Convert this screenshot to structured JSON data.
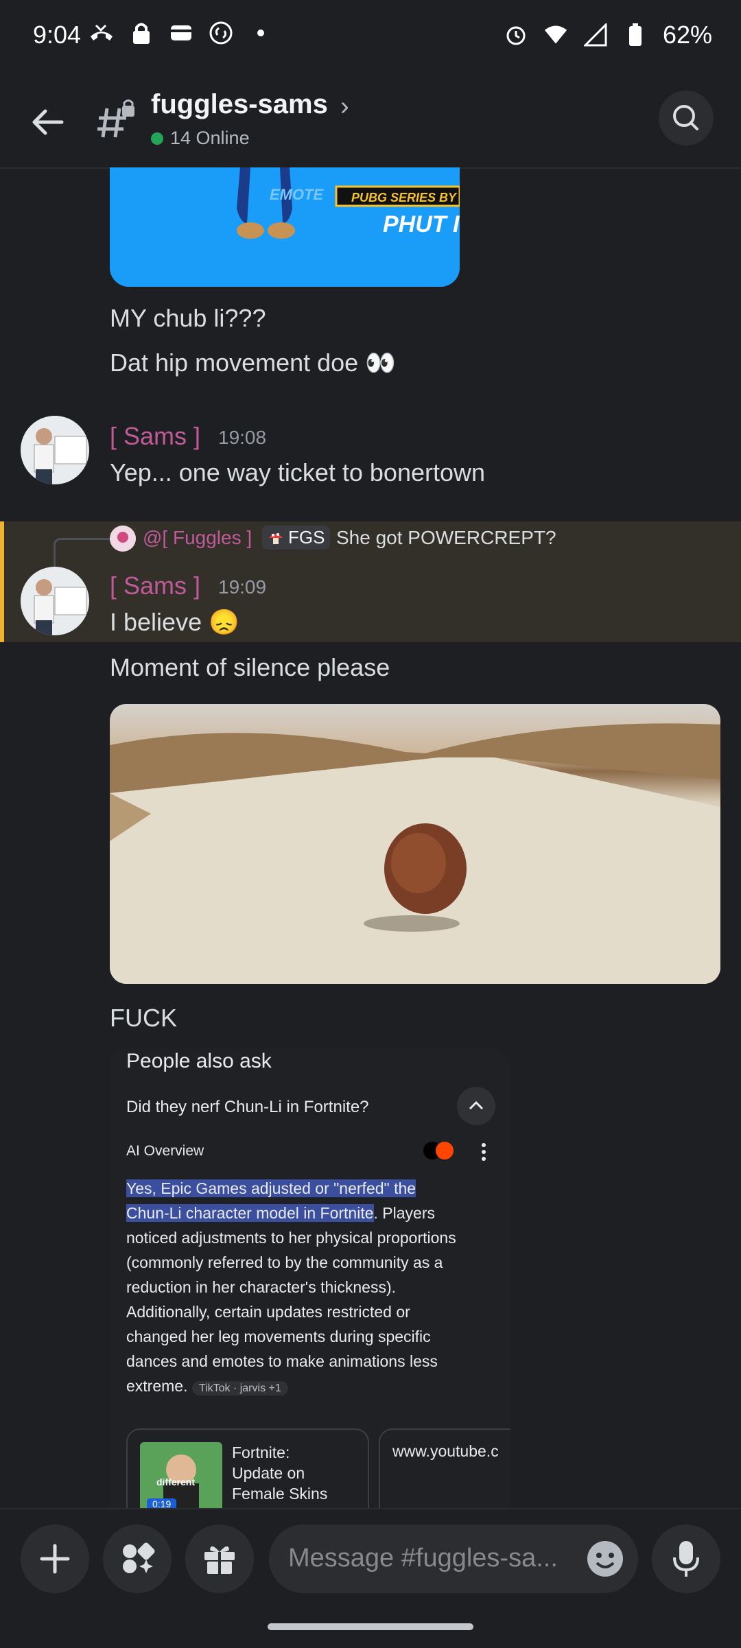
{
  "status_bar": {
    "time": "9:04",
    "battery": "62%"
  },
  "header": {
    "channel_name": "fuggles-sams",
    "chevron": "›",
    "online": "14 Online"
  },
  "messages": {
    "img1_overlay_emote": "EMOTE",
    "img1_overlay_series": "PUBG SERIES BY",
    "img1_overlay_name": "PHUT I",
    "line1": "MY chub li???",
    "line2": "Dat hip movement doe 👀",
    "m1_user": "[ Sams ]",
    "m1_time": "19:08",
    "m1_text": "Yep... one way ticket to bonertown",
    "reply_user": "@[ Fuggles ]",
    "reply_tag": "FGS",
    "reply_text": "She got POWERCREPT?",
    "m2_user": "[ Sams ]",
    "m2_time": "19:09",
    "m2_text": "I believe 😞",
    "m2_line2": "Moment of silence please",
    "m2_line3": "FUCK"
  },
  "card": {
    "section": "People also ask",
    "question": "Did they nerf Chun-Li in Fortnite?",
    "ai_overview": "AI Overview",
    "highlight1": "Yes, Epic Games adjusted or \"nerfed\" the",
    "highlight2": "Chun-Li character model in Fortnite",
    "body_after": ". Players",
    "body_lines": [
      "noticed adjustments to her physical proportions",
      "(commonly referred to by the community as a",
      "reduction in her character's thickness).",
      "Additionally, certain updates restricted or",
      "changed her leg movements during specific",
      "dances and emotes to make animations less"
    ],
    "body_last": "extreme.",
    "source_chip": "TikTok · jarvis +1",
    "video_title_1": "Fortnite:",
    "video_title_2": "Update on",
    "video_title_3": "Female Skins",
    "video_caption": "different",
    "video_duration": "0:19",
    "second_link": "www.youtube.c"
  },
  "composer": {
    "placeholder": "Message #fuggles-sa..."
  },
  "colors": {
    "accent_username": "#c05a98",
    "online_green": "#23a55a",
    "highlight_bar": "#f0b232"
  }
}
